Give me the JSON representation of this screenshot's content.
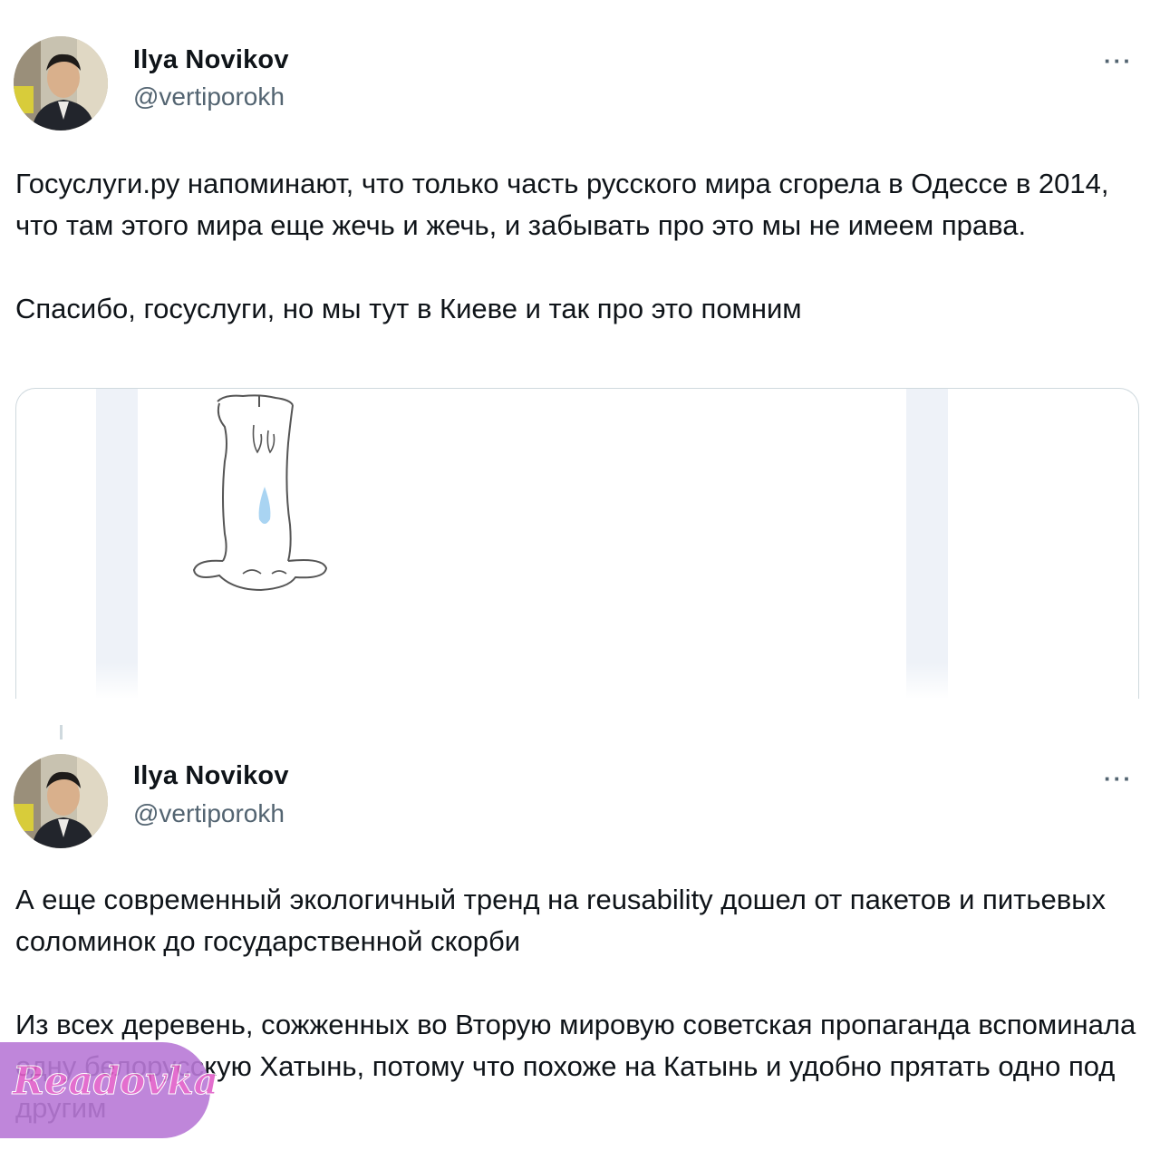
{
  "tweets": [
    {
      "author": {
        "name": "Ilya Novikov",
        "handle": "@vertiporokh"
      },
      "more_label": "···",
      "paragraphs": [
        "Госуслуги.ру напоминают, что только часть русского мира сгорела в Одессе в 2014, что там этого мира еще жечь и жечь, и забывать про это мы не имеем права.",
        "Спасибо, госуслуги, но мы тут в Киеве и так про это помним"
      ],
      "media": {
        "description_icon": "candle-icon"
      }
    },
    {
      "author": {
        "name": "Ilya Novikov",
        "handle": "@vertiporokh"
      },
      "more_label": "···",
      "paragraphs": [
        "А еще современный экологичный тренд на reusability дошел от пакетов и питьевых соломинок до государственной скорби",
        "Из всех деревень, сожженных во Вторую мировую советская пропаганда вспоминала одну белорусскую Хатынь, потому что похоже на Катынь и удобно прятать одно под другим"
      ]
    }
  ],
  "watermark": {
    "text": "Readovka"
  },
  "colors": {
    "text": "#0f1419",
    "secondary": "#536471",
    "border": "#cfd9de",
    "watermark": "#b979d7"
  }
}
